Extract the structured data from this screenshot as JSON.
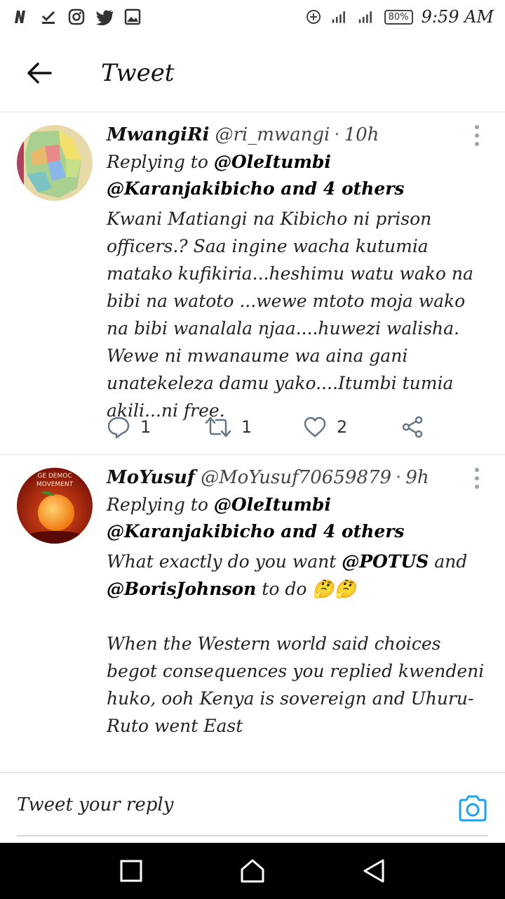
{
  "status_bar": {
    "time": "9:59 AM",
    "battery": "80%",
    "left_icons": [
      "netflix-n-icon",
      "download-check-icon",
      "instagram-icon",
      "twitter-icon",
      "gallery-icon"
    ],
    "right_icons": [
      "data-saver-icon",
      "signal-icon",
      "signal-icon",
      "battery-icon"
    ]
  },
  "header": {
    "title": "Tweet"
  },
  "tweets": [
    {
      "name": "MwangiRi",
      "handle": "@ri_mwangi",
      "time": "10h",
      "replying_prefix": "Replying to",
      "replying_to": "@OleItumbi @Karanjakibicho and 4 others",
      "text": "Kwani Matiangi na Kibicho ni prison officers.? Saa ingine wacha kutumia matako kufikiria...heshimu watu wako na bibi na watoto ...wewe mtoto moja wako na bibi wanalala njaa....huwezi walisha. Wewe ni mwanaume wa aina gani unatekeleza damu yako....Itumbi tumia akili...ni free.",
      "reply_count": "1",
      "retweet_count": "1",
      "like_count": "2"
    },
    {
      "name": "MoYusuf",
      "handle": "@MoYusuf70659879",
      "time": "9h",
      "replying_prefix": "Replying to",
      "replying_to": "@OleItumbi @Karanjakibicho and 4 others",
      "text_part1": "What exactly do you want ",
      "mention1": "@POTUS",
      "text_part2": " and ",
      "mention2": "@BorisJohnson",
      "text_part3": " to do 🤔🤔",
      "text_rest": "When the Western world said choices begot consequences you replied kwendeni huko, ooh Kenya is sovereign and Uhuru-Ruto went East\n\nWhy not tag China...or Kenya is one of the",
      "avatar_text": "GE DEMOC MOVEMENT"
    }
  ],
  "reply_bar": {
    "placeholder": "Tweet your reply"
  },
  "colors": {
    "accent": "#1da1f2",
    "action_gray": "#657786",
    "divider": "#e1e8ed"
  }
}
